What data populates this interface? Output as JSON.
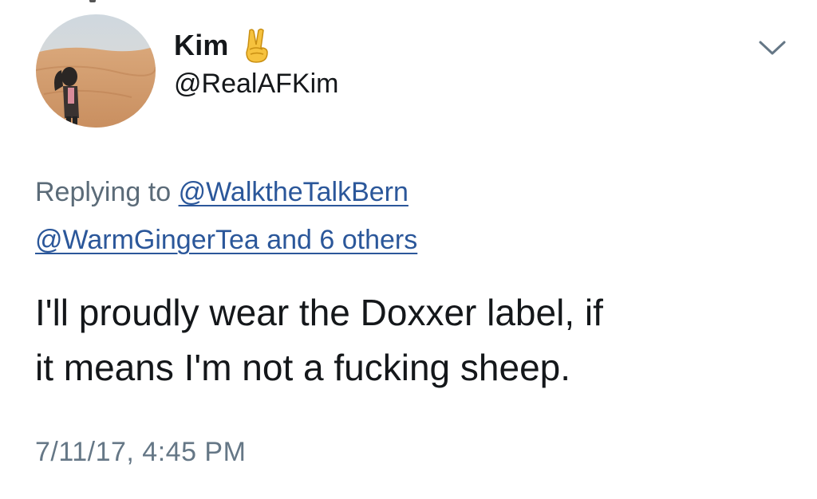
{
  "user": {
    "display_name": "Kim",
    "emoji_icon": "victory-hand-icon",
    "handle": "@RealAFKim"
  },
  "reply": {
    "prefix": "Replying to",
    "mention_1": "@WalktheTalkBern",
    "mention_2": "@WarmGingerTea and 6 others"
  },
  "tweet": {
    "line_1": "I'll proudly wear the Doxxer label, if",
    "line_2": "it means I'm not a fucking sheep.",
    "timestamp": "7/11/17, 4:45 PM"
  },
  "colors": {
    "text": "#14171a",
    "secondary": "#657786",
    "link": "#2b579a"
  }
}
